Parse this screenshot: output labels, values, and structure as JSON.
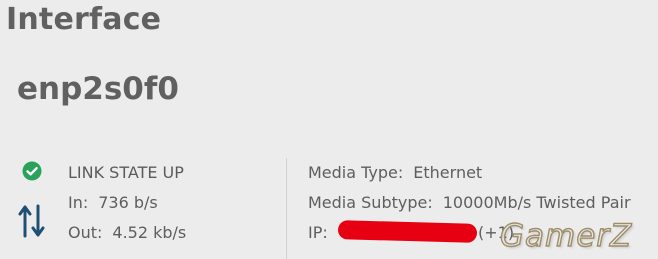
{
  "section_title": "Interface",
  "interface_name": "enp2s0f0",
  "status": {
    "icon": "check-circle-icon",
    "color": "#2aa35a",
    "link_state": "LINK STATE UP"
  },
  "traffic": {
    "icon": "arrows-up-down-icon",
    "icon_color": "#1f4f72",
    "in_label": "In:",
    "in_value": "736 b/s",
    "out_label": "Out:",
    "out_value": "4.52 kb/s"
  },
  "media": {
    "type_label": "Media Type:",
    "type_value": "Ethernet",
    "subtype_label": "Media Subtype:",
    "subtype_value": "10000Mb/s Twisted Pair",
    "ip_label": "IP:",
    "ip_extra": "(+1)"
  },
  "watermark": "GamerZ"
}
